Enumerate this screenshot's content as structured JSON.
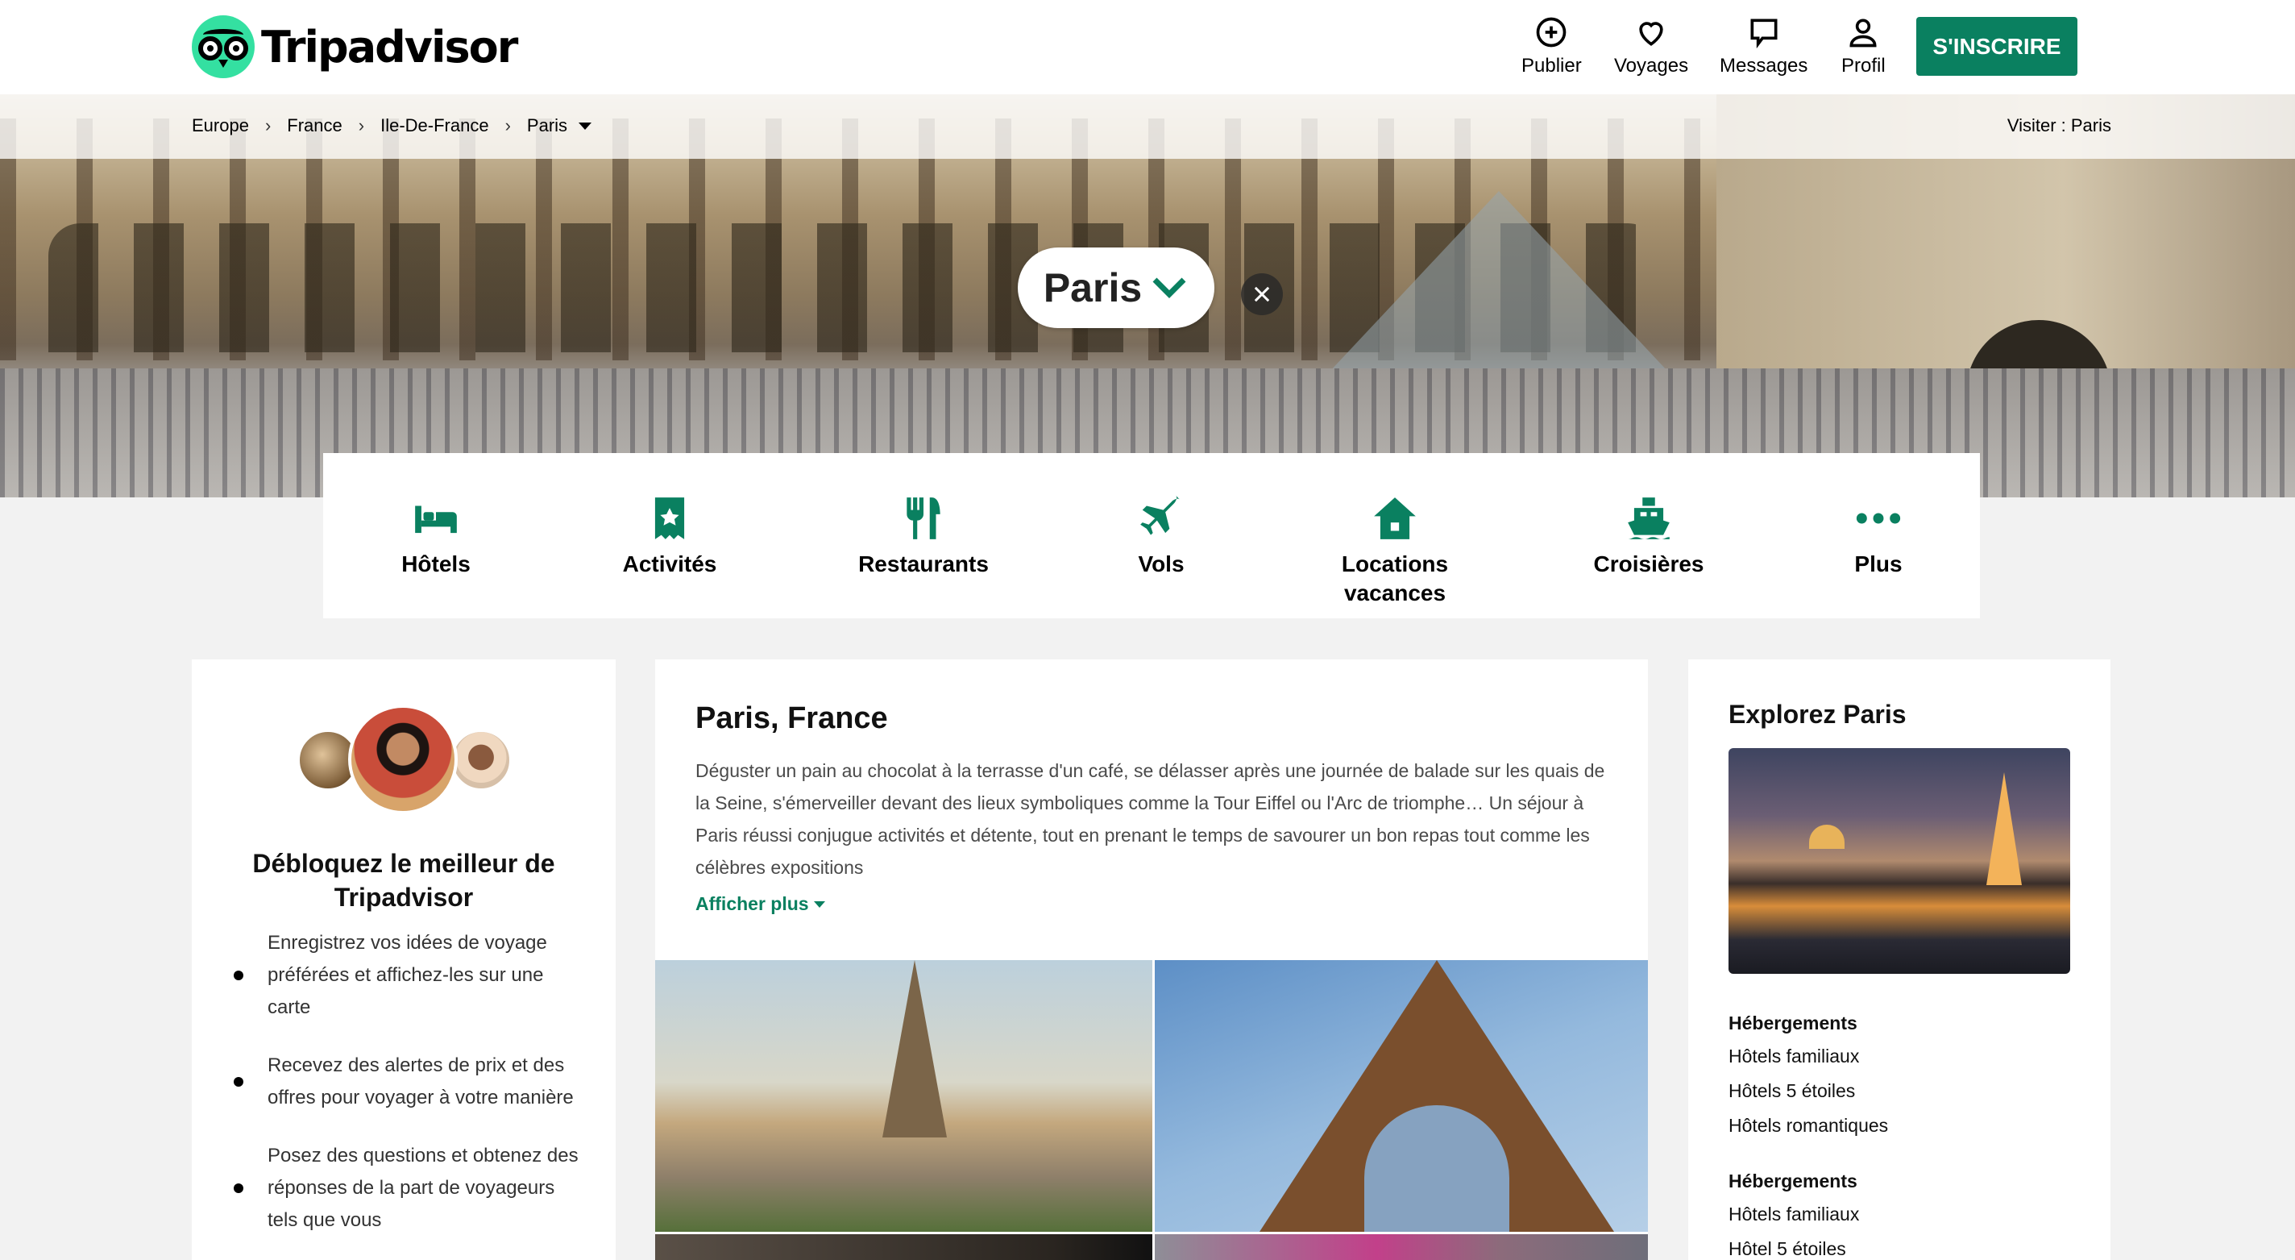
{
  "header": {
    "logo_text": "Tripadvisor",
    "nav": [
      {
        "label": "Publier",
        "icon": "plus-circle-icon"
      },
      {
        "label": "Voyages",
        "icon": "heart-icon"
      },
      {
        "label": "Messages",
        "icon": "message-icon"
      },
      {
        "label": "Profil",
        "icon": "user-icon"
      }
    ],
    "signup_label": "S'INSCRIRE",
    "accent_color": "#0a8060",
    "logo_color": "#34e0a1"
  },
  "breadcrumb": {
    "items": [
      "Europe",
      "France",
      "Ile-De-France",
      "Paris"
    ],
    "visit_label": "Visiter : Paris"
  },
  "hero": {
    "city_name": "Paris"
  },
  "categories": [
    {
      "label": "Hôtels",
      "icon": "bed-icon"
    },
    {
      "label": "Activités",
      "icon": "ticket-icon"
    },
    {
      "label": "Restaurants",
      "icon": "fork-knife-icon"
    },
    {
      "label": "Vols",
      "icon": "plane-icon"
    },
    {
      "label": "Locations vacances",
      "icon": "house-icon"
    },
    {
      "label": "Croisières",
      "icon": "ship-icon"
    },
    {
      "label": "Plus",
      "icon": "more-dots-icon"
    }
  ],
  "left_card": {
    "title": "Débloquez le meilleur de Tripadvisor",
    "items": [
      "Enregistrez vos idées de voyage préférées et affichez-les sur une carte",
      "Recevez des alertes de prix et des offres pour voyager à votre manière",
      "Posez des questions et obtenez des réponses de la part de voyageurs tels que vous"
    ]
  },
  "mid_card": {
    "title": "Paris, France",
    "description": "Déguster un pain au chocolat à la terrasse d'un café, se délasser après une journée de balade sur les quais de la Seine, s'émerveiller devant des lieux symboliques comme la Tour Eiffel ou l'Arc de triomphe… Un séjour à Paris réussi conjugue activités et détente, tout en prenant le temps de savourer un bon repas tout comme les célèbres expositions",
    "show_more": "Afficher plus"
  },
  "right_card": {
    "title": "Explorez Paris",
    "sections": [
      {
        "heading": "Hébergements",
        "links": [
          "Hôtels familiaux",
          "Hôtels 5 étoiles",
          "Hôtels romantiques"
        ]
      },
      {
        "heading": "Hébergements",
        "links": [
          "Hôtels familiaux",
          "Hôtel 5 étoiles"
        ]
      }
    ]
  }
}
